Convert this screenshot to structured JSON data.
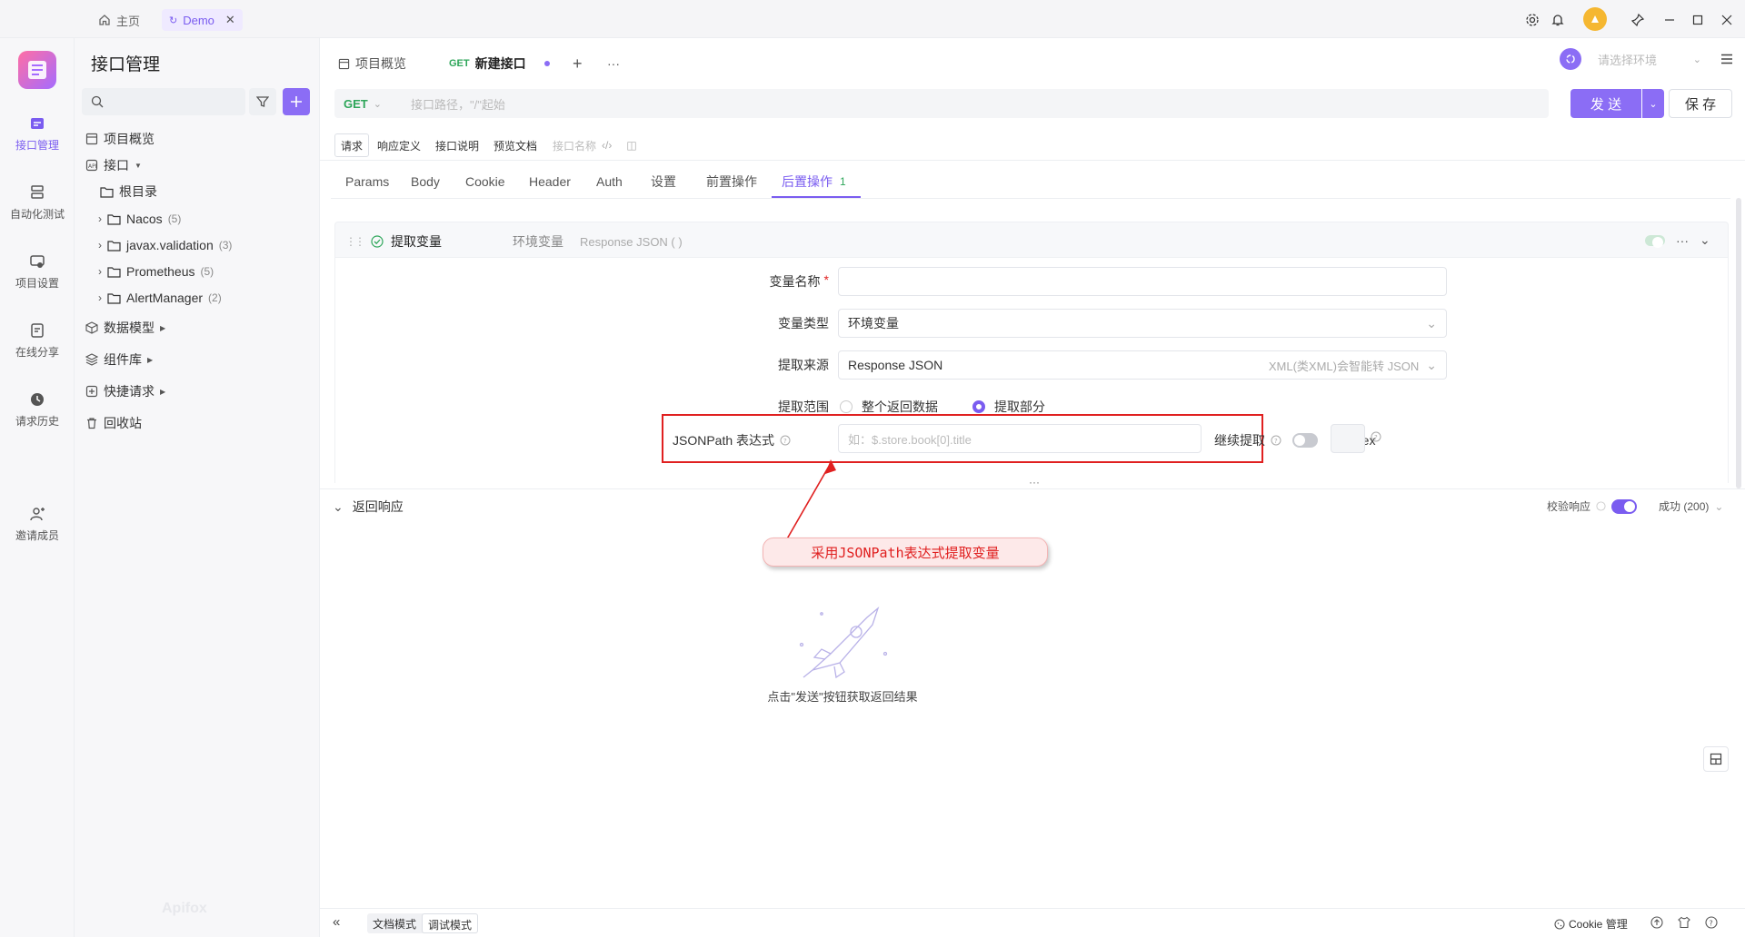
{
  "titlebar": {
    "home_label": "主页",
    "demo_tab_label": "Demo"
  },
  "leftnav": {
    "items": [
      {
        "label": "接口管理",
        "icon": "api-icon"
      },
      {
        "label": "自动化测试",
        "icon": "automation-icon"
      },
      {
        "label": "项目设置",
        "icon": "settings-icon"
      },
      {
        "label": "在线分享",
        "icon": "share-icon"
      },
      {
        "label": "请求历史",
        "icon": "history-icon"
      },
      {
        "label": "邀请成员",
        "icon": "invite-icon"
      }
    ]
  },
  "sidebar": {
    "title": "接口管理",
    "tree": {
      "overview": "项目概览",
      "api": "接口",
      "root": "根目录",
      "folders": [
        {
          "name": "Nacos",
          "count": "(5)"
        },
        {
          "name": "javax.validation",
          "count": "(3)"
        },
        {
          "name": "Prometheus",
          "count": "(5)"
        },
        {
          "name": "AlertManager",
          "count": "(2)"
        }
      ],
      "data_model": "数据模型",
      "components": "组件库",
      "quick_request": "快捷请求",
      "recycle": "回收站"
    },
    "watermark": "Apifox"
  },
  "tabs": {
    "overview": "项目概览",
    "active_method": "GET",
    "active_label": "新建接口",
    "add": "+",
    "more": "···"
  },
  "env": {
    "placeholder": "请选择环境"
  },
  "request": {
    "method": "GET",
    "url_placeholder": "接口路径，\"/\"起始",
    "send_label": "发 送",
    "save_label": "保 存"
  },
  "subtabs": {
    "items": [
      "请求",
      "响应定义",
      "接口说明",
      "预览文档"
    ],
    "name_placeholder": "接口名称"
  },
  "param_tabs": {
    "items": [
      "Params",
      "Body",
      "Cookie",
      "Header",
      "Auth",
      "设置",
      "前置操作",
      "后置操作"
    ],
    "active_badge": "1"
  },
  "extract": {
    "title": "提取变量",
    "summary_type": "环境变量",
    "summary_source": "Response JSON ( )",
    "var_name_label": "变量名称",
    "required_mark": "*",
    "var_type_label": "变量类型",
    "var_type_value": "环境变量",
    "source_label": "提取来源",
    "source_value": "Response JSON",
    "source_hint": "XML(类XML)会智能转 JSON",
    "range_label": "提取范围",
    "range_options": [
      "整个返回数据",
      "提取部分"
    ],
    "jsonpath_label": "JSONPath 表达式",
    "jsonpath_placeholder": "如：$.store.book[0].title",
    "continue_label": "继续提取",
    "index_label": "index"
  },
  "annotation": {
    "text": "采用JSONPath表达式提取变量",
    "color": "#e02020"
  },
  "response": {
    "title": "返回响应",
    "verify_label": "校验响应",
    "status_value": "成功 (200)",
    "empty_text": "点击\"发送\"按钮获取返回结果"
  },
  "footer": {
    "doc_mode": "文档模式",
    "debug_mode": "调试模式",
    "cookie_label": "Cookie 管理"
  },
  "colors": {
    "accent": "#7a5cf0",
    "get_green": "#2ea65a"
  }
}
